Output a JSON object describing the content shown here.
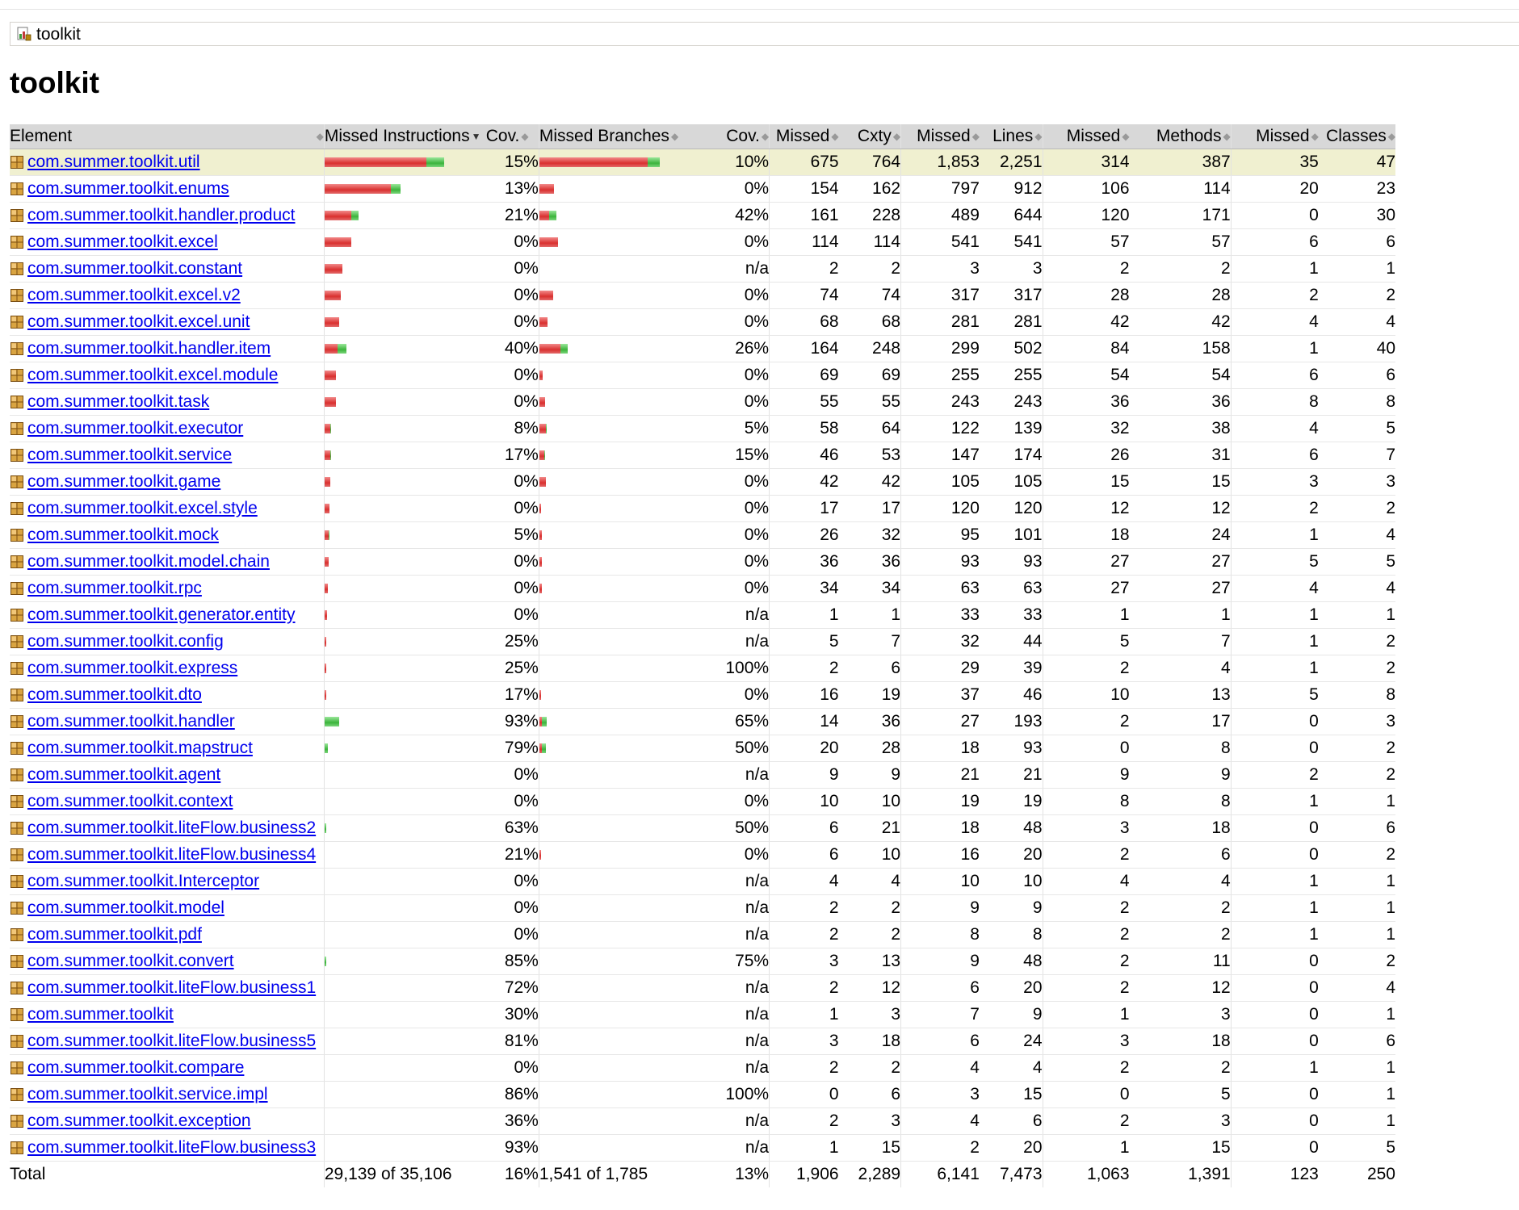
{
  "breadcrumb": {
    "label": "toolkit",
    "icon": "report-icon"
  },
  "page_title": "toolkit",
  "colors": {
    "missed": "#d9302f",
    "covered": "#3cb43c",
    "link": "#0000ee",
    "highlight_row": "#f0f0d0",
    "header_bg": "#d8d8d8"
  },
  "header": {
    "element": "Element",
    "missed_instructions": "Missed Instructions",
    "cov1": "Cov.",
    "missed_branches": "Missed Branches",
    "cov2": "Cov.",
    "missed_cxty": "Missed",
    "cxty": "Cxty",
    "missed_lines": "Missed",
    "lines": "Lines",
    "missed_methods": "Missed",
    "methods": "Methods",
    "missed_classes": "Missed",
    "classes": "Classes"
  },
  "rows": [
    {
      "name": "com.summer.toolkit.util",
      "ir": 126,
      "ig": 22,
      "icov": "15%",
      "br": 134,
      "bg": 15,
      "bcov": "10%",
      "mc": "675",
      "c": "764",
      "ml": "1,853",
      "l": "2,251",
      "mm": "314",
      "m": "387",
      "mcl": "35",
      "cl": "47"
    },
    {
      "name": "com.summer.toolkit.enums",
      "ir": 82,
      "ig": 12,
      "icov": "13%",
      "br": 18,
      "bg": 0,
      "bcov": "0%",
      "mc": "154",
      "c": "162",
      "ml": "797",
      "l": "912",
      "mm": "106",
      "m": "114",
      "mcl": "20",
      "cl": "23"
    },
    {
      "name": "com.summer.toolkit.handler.product",
      "ir": 33,
      "ig": 9,
      "icov": "21%",
      "br": 12,
      "bg": 9,
      "bcov": "42%",
      "mc": "161",
      "c": "228",
      "ml": "489",
      "l": "644",
      "mm": "120",
      "m": "171",
      "mcl": "0",
      "cl": "30"
    },
    {
      "name": "com.summer.toolkit.excel",
      "ir": 33,
      "ig": 0,
      "icov": "0%",
      "br": 23,
      "bg": 0,
      "bcov": "0%",
      "mc": "114",
      "c": "114",
      "ml": "541",
      "l": "541",
      "mm": "57",
      "m": "57",
      "mcl": "6",
      "cl": "6"
    },
    {
      "name": "com.summer.toolkit.constant",
      "ir": 22,
      "ig": 0,
      "icov": "0%",
      "br": 0,
      "bg": 0,
      "bcov": "n/a",
      "mc": "2",
      "c": "2",
      "ml": "3",
      "l": "3",
      "mm": "2",
      "m": "2",
      "mcl": "1",
      "cl": "1"
    },
    {
      "name": "com.summer.toolkit.excel.v2",
      "ir": 20,
      "ig": 0,
      "icov": "0%",
      "br": 17,
      "bg": 0,
      "bcov": "0%",
      "mc": "74",
      "c": "74",
      "ml": "317",
      "l": "317",
      "mm": "28",
      "m": "28",
      "mcl": "2",
      "cl": "2"
    },
    {
      "name": "com.summer.toolkit.excel.unit",
      "ir": 18,
      "ig": 0,
      "icov": "0%",
      "br": 10,
      "bg": 0,
      "bcov": "0%",
      "mc": "68",
      "c": "68",
      "ml": "281",
      "l": "281",
      "mm": "42",
      "m": "42",
      "mcl": "4",
      "cl": "4"
    },
    {
      "name": "com.summer.toolkit.handler.item",
      "ir": 16,
      "ig": 11,
      "icov": "40%",
      "br": 26,
      "bg": 9,
      "bcov": "26%",
      "mc": "164",
      "c": "248",
      "ml": "299",
      "l": "502",
      "mm": "84",
      "m": "158",
      "mcl": "1",
      "cl": "40"
    },
    {
      "name": "com.summer.toolkit.excel.module",
      "ir": 14,
      "ig": 0,
      "icov": "0%",
      "br": 4,
      "bg": 0,
      "bcov": "0%",
      "mc": "69",
      "c": "69",
      "ml": "255",
      "l": "255",
      "mm": "54",
      "m": "54",
      "mcl": "6",
      "cl": "6"
    },
    {
      "name": "com.summer.toolkit.task",
      "ir": 14,
      "ig": 0,
      "icov": "0%",
      "br": 7,
      "bg": 0,
      "bcov": "0%",
      "mc": "55",
      "c": "55",
      "ml": "243",
      "l": "243",
      "mm": "36",
      "m": "36",
      "mcl": "8",
      "cl": "8"
    },
    {
      "name": "com.summer.toolkit.executor",
      "ir": 7,
      "ig": 1,
      "icov": "8%",
      "br": 8,
      "bg": 1,
      "bcov": "5%",
      "mc": "58",
      "c": "64",
      "ml": "122",
      "l": "139",
      "mm": "32",
      "m": "38",
      "mcl": "4",
      "cl": "5"
    },
    {
      "name": "com.summer.toolkit.service",
      "ir": 7,
      "ig": 1,
      "icov": "17%",
      "br": 6,
      "bg": 1,
      "bcov": "15%",
      "mc": "46",
      "c": "53",
      "ml": "147",
      "l": "174",
      "mm": "26",
      "m": "31",
      "mcl": "6",
      "cl": "7"
    },
    {
      "name": "com.summer.toolkit.game",
      "ir": 7,
      "ig": 0,
      "icov": "0%",
      "br": 8,
      "bg": 0,
      "bcov": "0%",
      "mc": "42",
      "c": "42",
      "ml": "105",
      "l": "105",
      "mm": "15",
      "m": "15",
      "mcl": "3",
      "cl": "3"
    },
    {
      "name": "com.summer.toolkit.excel.style",
      "ir": 6,
      "ig": 0,
      "icov": "0%",
      "br": 2,
      "bg": 0,
      "bcov": "0%",
      "mc": "17",
      "c": "17",
      "ml": "120",
      "l": "120",
      "mm": "12",
      "m": "12",
      "mcl": "2",
      "cl": "2"
    },
    {
      "name": "com.summer.toolkit.mock",
      "ir": 5,
      "ig": 1,
      "icov": "5%",
      "br": 3,
      "bg": 0,
      "bcov": "0%",
      "mc": "26",
      "c": "32",
      "ml": "95",
      "l": "101",
      "mm": "18",
      "m": "24",
      "mcl": "1",
      "cl": "4"
    },
    {
      "name": "com.summer.toolkit.model.chain",
      "ir": 5,
      "ig": 0,
      "icov": "0%",
      "br": 3,
      "bg": 0,
      "bcov": "0%",
      "mc": "36",
      "c": "36",
      "ml": "93",
      "l": "93",
      "mm": "27",
      "m": "27",
      "mcl": "5",
      "cl": "5"
    },
    {
      "name": "com.summer.toolkit.rpc",
      "ir": 4,
      "ig": 0,
      "icov": "0%",
      "br": 3,
      "bg": 0,
      "bcov": "0%",
      "mc": "34",
      "c": "34",
      "ml": "63",
      "l": "63",
      "mm": "27",
      "m": "27",
      "mcl": "4",
      "cl": "4"
    },
    {
      "name": "com.summer.toolkit.generator.entity",
      "ir": 3,
      "ig": 0,
      "icov": "0%",
      "br": 0,
      "bg": 0,
      "bcov": "n/a",
      "mc": "1",
      "c": "1",
      "ml": "33",
      "l": "33",
      "mm": "1",
      "m": "1",
      "mcl": "1",
      "cl": "1"
    },
    {
      "name": "com.summer.toolkit.config",
      "ir": 2,
      "ig": 0,
      "icov": "25%",
      "br": 0,
      "bg": 0,
      "bcov": "n/a",
      "mc": "5",
      "c": "7",
      "ml": "32",
      "l": "44",
      "mm": "5",
      "m": "7",
      "mcl": "1",
      "cl": "2"
    },
    {
      "name": "com.summer.toolkit.express",
      "ir": 2,
      "ig": 0,
      "icov": "25%",
      "br": 0,
      "bg": 0,
      "bcov": "100%",
      "mc": "2",
      "c": "6",
      "ml": "29",
      "l": "39",
      "mm": "2",
      "m": "4",
      "mcl": "1",
      "cl": "2"
    },
    {
      "name": "com.summer.toolkit.dto",
      "ir": 2,
      "ig": 0,
      "icov": "17%",
      "br": 2,
      "bg": 0,
      "bcov": "0%",
      "mc": "16",
      "c": "19",
      "ml": "37",
      "l": "46",
      "mm": "10",
      "m": "13",
      "mcl": "5",
      "cl": "8"
    },
    {
      "name": "com.summer.toolkit.handler",
      "ir": 0,
      "ig": 18,
      "icov": "93%",
      "br": 3,
      "bg": 6,
      "bcov": "65%",
      "mc": "14",
      "c": "36",
      "ml": "27",
      "l": "193",
      "mm": "2",
      "m": "17",
      "mcl": "0",
      "cl": "3"
    },
    {
      "name": "com.summer.toolkit.mapstruct",
      "ir": 0,
      "ig": 4,
      "icov": "79%",
      "br": 3,
      "bg": 5,
      "bcov": "50%",
      "mc": "20",
      "c": "28",
      "ml": "18",
      "l": "93",
      "mm": "0",
      "m": "8",
      "mcl": "0",
      "cl": "2"
    },
    {
      "name": "com.summer.toolkit.agent",
      "ir": 0,
      "ig": 0,
      "icov": "0%",
      "br": 0,
      "bg": 0,
      "bcov": "n/a",
      "mc": "9",
      "c": "9",
      "ml": "21",
      "l": "21",
      "mm": "9",
      "m": "9",
      "mcl": "2",
      "cl": "2"
    },
    {
      "name": "com.summer.toolkit.context",
      "ir": 0,
      "ig": 0,
      "icov": "0%",
      "br": 0,
      "bg": 0,
      "bcov": "0%",
      "mc": "10",
      "c": "10",
      "ml": "19",
      "l": "19",
      "mm": "8",
      "m": "8",
      "mcl": "1",
      "cl": "1"
    },
    {
      "name": "com.summer.toolkit.liteFlow.business2",
      "ir": 0,
      "ig": 2,
      "icov": "63%",
      "br": 0,
      "bg": 0,
      "bcov": "50%",
      "mc": "6",
      "c": "21",
      "ml": "18",
      "l": "48",
      "mm": "3",
      "m": "18",
      "mcl": "0",
      "cl": "6"
    },
    {
      "name": "com.summer.toolkit.liteFlow.business4",
      "ir": 0,
      "ig": 0,
      "icov": "21%",
      "br": 2,
      "bg": 0,
      "bcov": "0%",
      "mc": "6",
      "c": "10",
      "ml": "16",
      "l": "20",
      "mm": "2",
      "m": "6",
      "mcl": "0",
      "cl": "2"
    },
    {
      "name": "com.summer.toolkit.Interceptor",
      "ir": 0,
      "ig": 0,
      "icov": "0%",
      "br": 0,
      "bg": 0,
      "bcov": "n/a",
      "mc": "4",
      "c": "4",
      "ml": "10",
      "l": "10",
      "mm": "4",
      "m": "4",
      "mcl": "1",
      "cl": "1"
    },
    {
      "name": "com.summer.toolkit.model",
      "ir": 0,
      "ig": 0,
      "icov": "0%",
      "br": 0,
      "bg": 0,
      "bcov": "n/a",
      "mc": "2",
      "c": "2",
      "ml": "9",
      "l": "9",
      "mm": "2",
      "m": "2",
      "mcl": "1",
      "cl": "1"
    },
    {
      "name": "com.summer.toolkit.pdf",
      "ir": 0,
      "ig": 0,
      "icov": "0%",
      "br": 0,
      "bg": 0,
      "bcov": "n/a",
      "mc": "2",
      "c": "2",
      "ml": "8",
      "l": "8",
      "mm": "2",
      "m": "2",
      "mcl": "1",
      "cl": "1"
    },
    {
      "name": "com.summer.toolkit.convert",
      "ir": 0,
      "ig": 2,
      "icov": "85%",
      "br": 0,
      "bg": 0,
      "bcov": "75%",
      "mc": "3",
      "c": "13",
      "ml": "9",
      "l": "48",
      "mm": "2",
      "m": "11",
      "mcl": "0",
      "cl": "2"
    },
    {
      "name": "com.summer.toolkit.liteFlow.business1",
      "ir": 0,
      "ig": 0,
      "icov": "72%",
      "br": 0,
      "bg": 0,
      "bcov": "n/a",
      "mc": "2",
      "c": "12",
      "ml": "6",
      "l": "20",
      "mm": "2",
      "m": "12",
      "mcl": "0",
      "cl": "4"
    },
    {
      "name": "com.summer.toolkit",
      "ir": 0,
      "ig": 0,
      "icov": "30%",
      "br": 0,
      "bg": 0,
      "bcov": "n/a",
      "mc": "1",
      "c": "3",
      "ml": "7",
      "l": "9",
      "mm": "1",
      "m": "3",
      "mcl": "0",
      "cl": "1"
    },
    {
      "name": "com.summer.toolkit.liteFlow.business5",
      "ir": 0,
      "ig": 0,
      "icov": "81%",
      "br": 0,
      "bg": 0,
      "bcov": "n/a",
      "mc": "3",
      "c": "18",
      "ml": "6",
      "l": "24",
      "mm": "3",
      "m": "18",
      "mcl": "0",
      "cl": "6"
    },
    {
      "name": "com.summer.toolkit.compare",
      "ir": 0,
      "ig": 0,
      "icov": "0%",
      "br": 0,
      "bg": 0,
      "bcov": "n/a",
      "mc": "2",
      "c": "2",
      "ml": "4",
      "l": "4",
      "mm": "2",
      "m": "2",
      "mcl": "1",
      "cl": "1"
    },
    {
      "name": "com.summer.toolkit.service.impl",
      "ir": 0,
      "ig": 0,
      "icov": "86%",
      "br": 0,
      "bg": 0,
      "bcov": "100%",
      "mc": "0",
      "c": "6",
      "ml": "3",
      "l": "15",
      "mm": "0",
      "m": "5",
      "mcl": "0",
      "cl": "1"
    },
    {
      "name": "com.summer.toolkit.exception",
      "ir": 0,
      "ig": 0,
      "icov": "36%",
      "br": 0,
      "bg": 0,
      "bcov": "n/a",
      "mc": "2",
      "c": "3",
      "ml": "4",
      "l": "6",
      "mm": "2",
      "m": "3",
      "mcl": "0",
      "cl": "1"
    },
    {
      "name": "com.summer.toolkit.liteFlow.business3",
      "ir": 0,
      "ig": 0,
      "icov": "93%",
      "br": 0,
      "bg": 0,
      "bcov": "n/a",
      "mc": "1",
      "c": "15",
      "ml": "2",
      "l": "20",
      "mm": "1",
      "m": "15",
      "mcl": "0",
      "cl": "5"
    }
  ],
  "total": {
    "label": "Total",
    "missed_instructions": "29,139 of 35,106",
    "icov": "16%",
    "missed_branches": "1,541 of 1,785",
    "bcov": "13%",
    "mc": "1,906",
    "c": "2,289",
    "ml": "6,141",
    "l": "7,473",
    "mm": "1,063",
    "m": "1,391",
    "mcl": "123",
    "cl": "250"
  }
}
